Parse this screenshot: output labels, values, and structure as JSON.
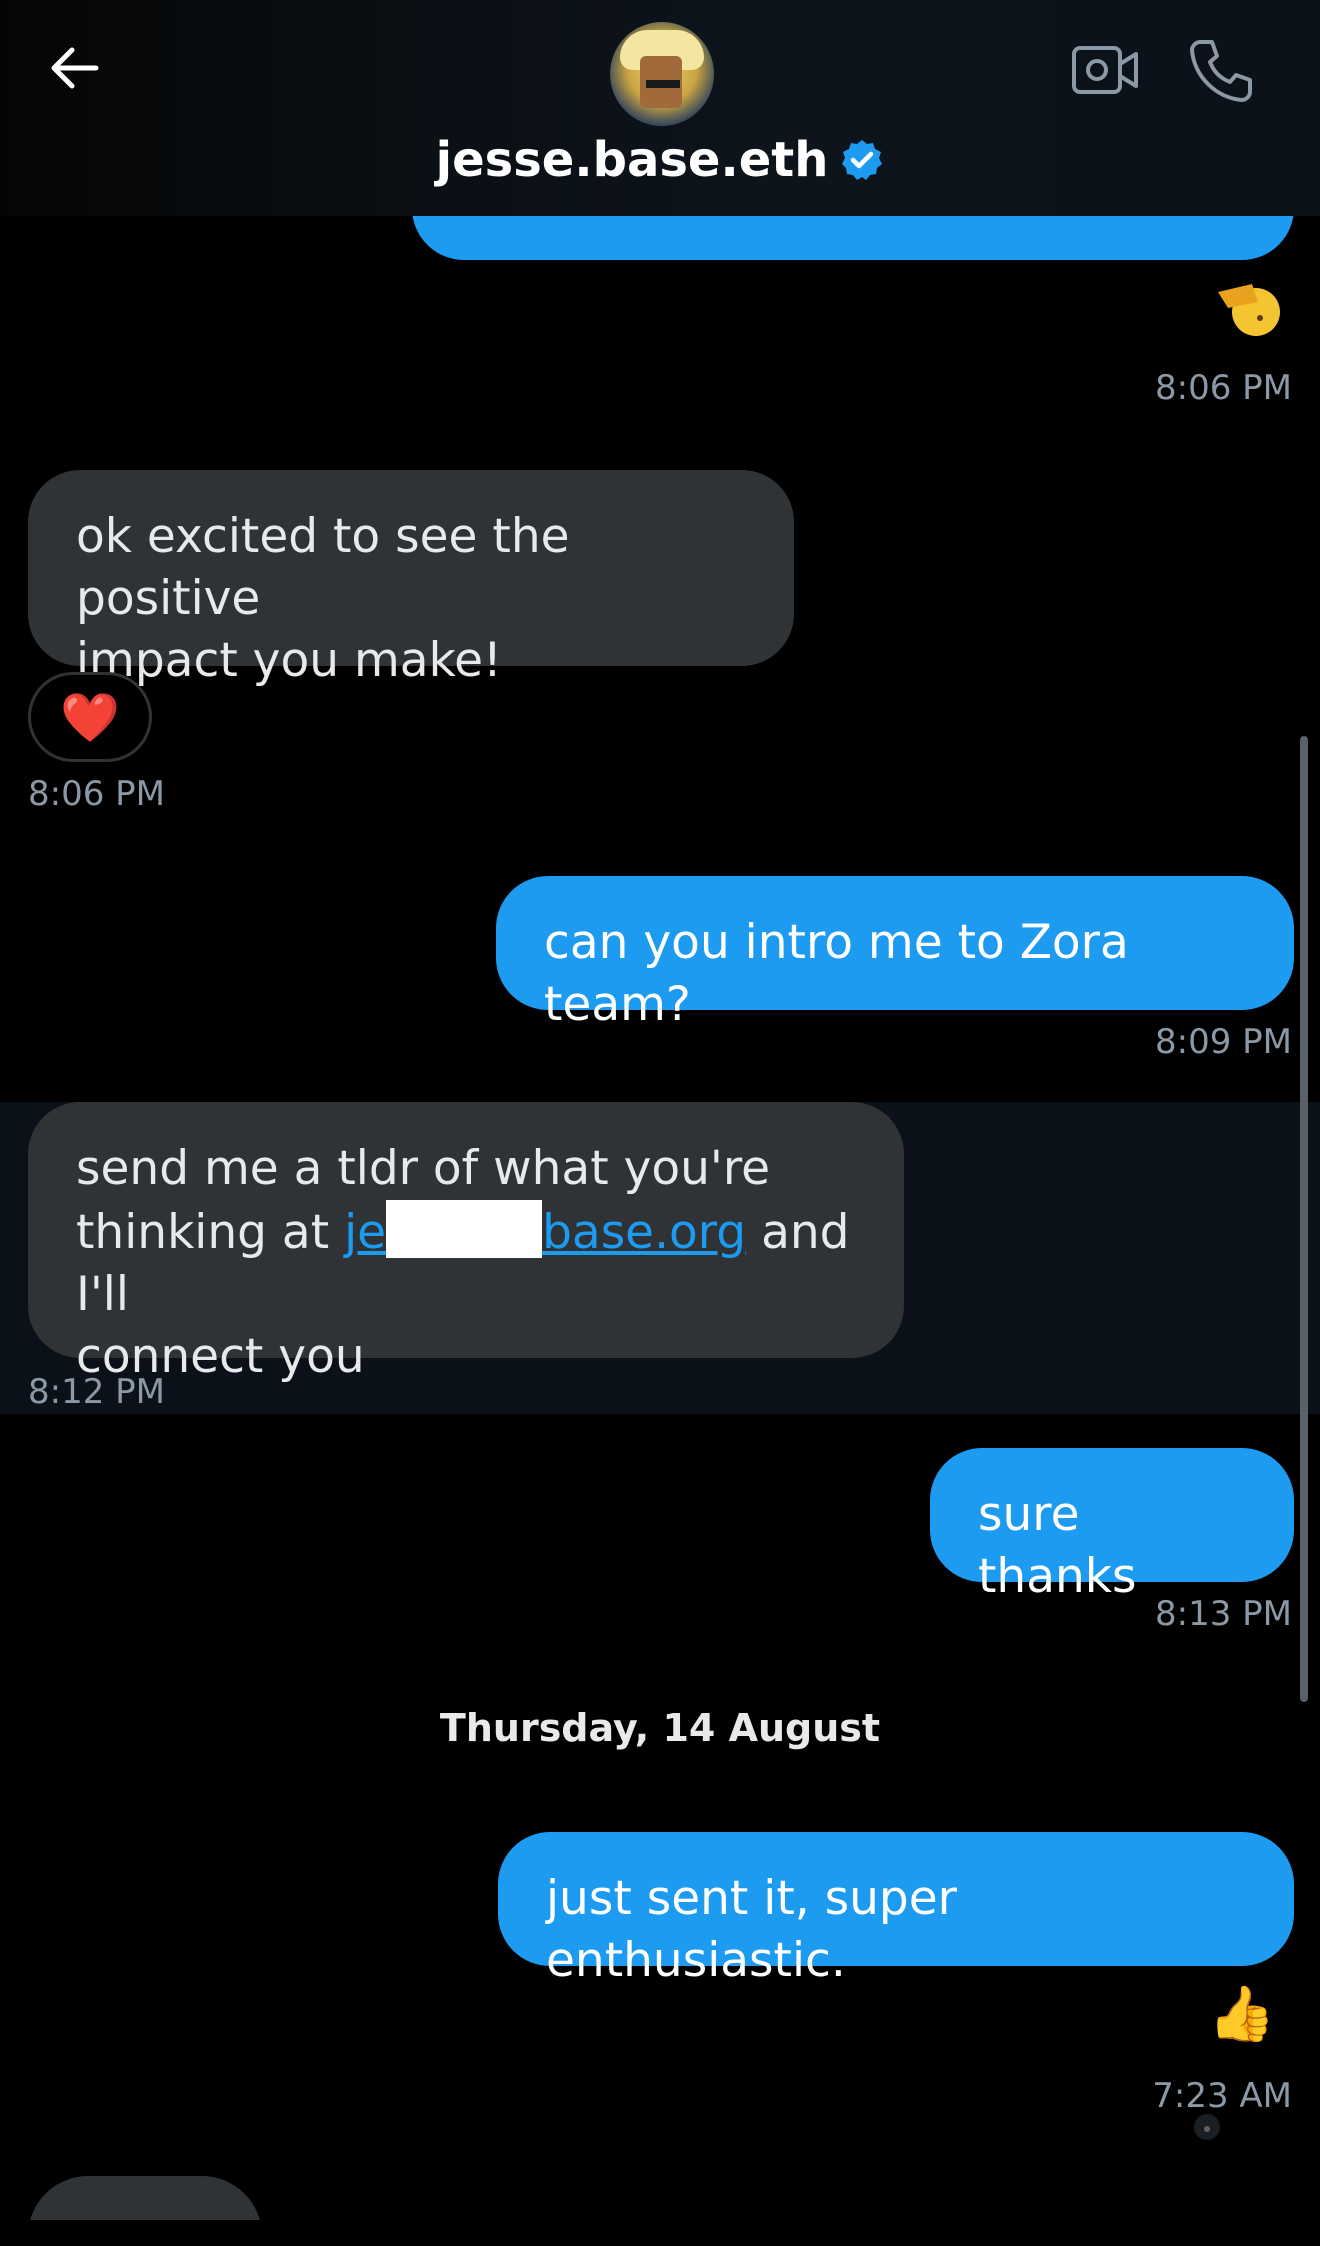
{
  "header": {
    "contact_name": "jesse.base.eth",
    "icons": [
      "back-arrow-icon",
      "avatar",
      "verified-badge-icon",
      "video-call-icon",
      "phone-call-icon"
    ]
  },
  "colors": {
    "sent_bubble": "#1d9bf0",
    "received_bubble": "#2f3336",
    "timestamp": "#8b98a5",
    "verified": "#1d9bf0"
  },
  "messages": [
    {
      "id": "m1",
      "direction": "sent",
      "reaction": "salute-emoji",
      "time": "8:06 PM"
    },
    {
      "id": "m2",
      "direction": "received",
      "text": "ok excited to see the positive impact you make!",
      "line1": "ok excited to see the positive",
      "line2": "impact you make!",
      "reaction": "❤️",
      "time": "8:06 PM"
    },
    {
      "id": "m3",
      "direction": "sent",
      "text": "can you intro me to Zora team?",
      "time": "8:09 PM"
    },
    {
      "id": "m4",
      "direction": "received",
      "line1": "send me a tldr of what you're",
      "line2_prefix": "thinking at ",
      "link_start": "je",
      "link_end": "base.org",
      "line2_suffix": " and I'll",
      "line3": "connect you",
      "time": "8:12 PM"
    },
    {
      "id": "m5",
      "direction": "sent",
      "text": "sure thanks",
      "time": "8:13 PM"
    },
    {
      "id": "m6",
      "direction": "sent",
      "text": "just sent it, super enthusiastic.",
      "reaction": "👍",
      "time": "7:23 AM"
    }
  ],
  "date_separator": "Thursday, 14 August"
}
